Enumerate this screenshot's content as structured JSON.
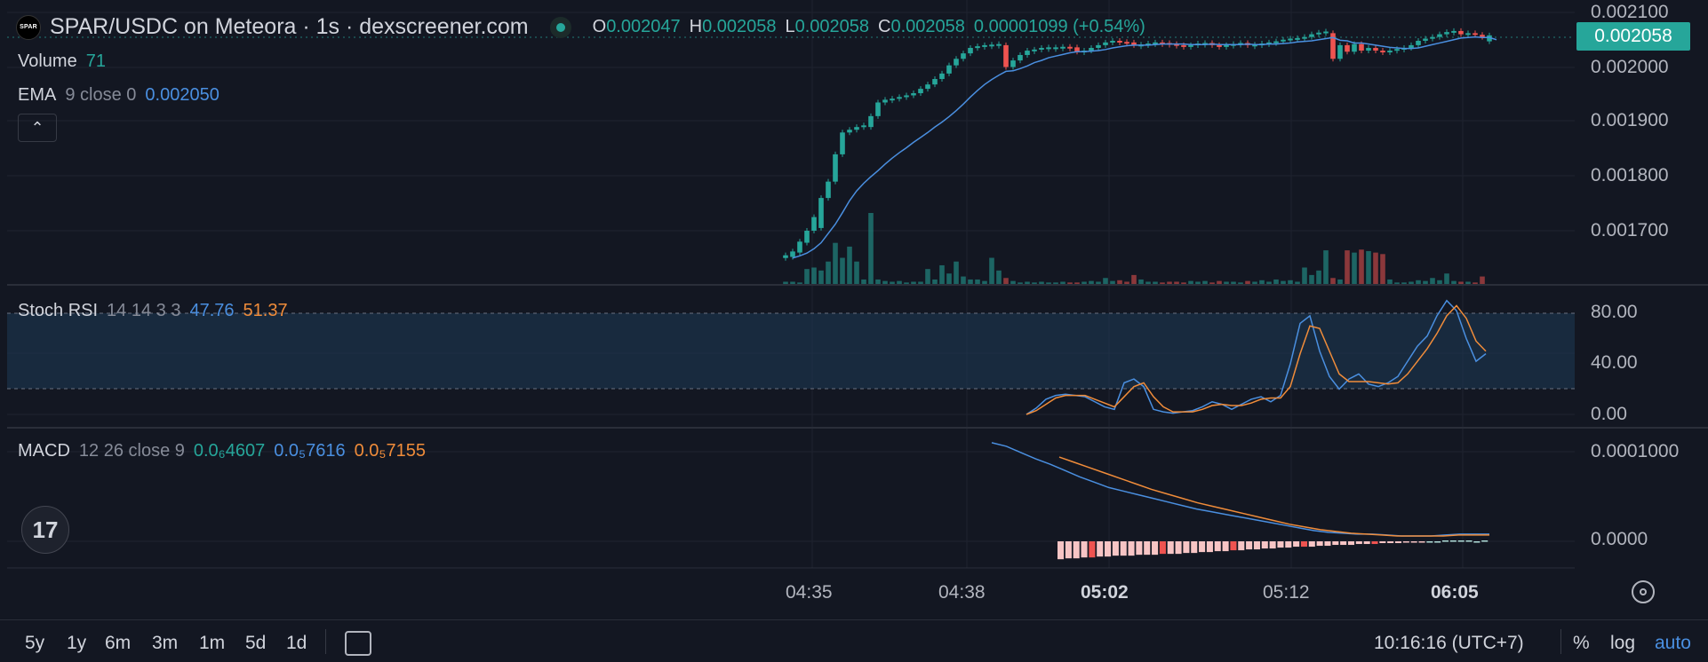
{
  "header": {
    "logo_text": "SPAR",
    "title": "SPAR/USDC on Meteora · 1s · dexscreener.com",
    "ohlc": [
      {
        "k": "O",
        "v": "0.002047"
      },
      {
        "k": "H",
        "v": "0.002058"
      },
      {
        "k": "L",
        "v": "0.002058"
      },
      {
        "k": "C",
        "v": "0.002058"
      }
    ],
    "change": "0.00001099 (+0.54%)"
  },
  "volume": {
    "label": "Volume",
    "value": "71"
  },
  "ema": {
    "label": "EMA",
    "params": "9 close 0",
    "value": "0.002050"
  },
  "stoch_rsi": {
    "label": "Stoch RSI",
    "params": "14 14 3 3",
    "k": "47.76",
    "d": "51.37"
  },
  "macd": {
    "label": "MACD",
    "params": "12 26 close 9",
    "hist": "0.0₆4607",
    "macd": "0.0₅7616",
    "signal": "0.0₅7155"
  },
  "last_price": "0.002058",
  "bottom_bar": {
    "ranges": [
      "5y",
      "1y",
      "6m",
      "3m",
      "1m",
      "5d",
      "1d"
    ],
    "clock": "10:16:16 (UTC+7)",
    "percent": "%",
    "log": "log",
    "auto": "auto"
  },
  "colors": {
    "up": "#26a69a",
    "down": "#ef5350",
    "ema": "#4a8fe0",
    "stoch_k": "#4a8fe0",
    "stoch_d": "#f08c3a",
    "background": "#131722"
  },
  "chart_data": {
    "type": "candlestick",
    "x_axis": {
      "ticks": [
        {
          "label": "04:35",
          "bold": false
        },
        {
          "label": "04:38",
          "bold": false
        },
        {
          "label": "05:02",
          "bold": true
        },
        {
          "label": "05:12",
          "bold": false
        },
        {
          "label": "06:05",
          "bold": true
        }
      ]
    },
    "price_axis": {
      "ticks": [
        "0.002100",
        "0.002000",
        "0.001900",
        "0.001800",
        "0.001700"
      ],
      "range": [
        0.00161,
        0.00211
      ]
    },
    "stoch_axis": {
      "ticks": [
        "80.00",
        "40.00",
        "0.00"
      ],
      "range": [
        -5,
        95
      ],
      "bands": [
        20,
        80
      ]
    },
    "macd_axis": {
      "ticks": [
        "0.0001000",
        "0.0000"
      ],
      "range": [
        -1.5e-05,
        0.00012
      ]
    },
    "candles": [
      {
        "o": 0.00165,
        "c": 0.001655
      },
      {
        "o": 0.001652,
        "c": 0.001662
      },
      {
        "o": 0.00166,
        "c": 0.00168
      },
      {
        "o": 0.001678,
        "c": 0.0017
      },
      {
        "o": 0.0017,
        "c": 0.001725
      },
      {
        "o": 0.001705,
        "c": 0.00176
      },
      {
        "o": 0.00176,
        "c": 0.00179
      },
      {
        "o": 0.00179,
        "c": 0.00184
      },
      {
        "o": 0.00184,
        "c": 0.00188
      },
      {
        "o": 0.00188,
        "c": 0.001885
      },
      {
        "o": 0.001885,
        "c": 0.00189
      },
      {
        "o": 0.00189,
        "c": 0.001893
      },
      {
        "o": 0.00189,
        "c": 0.00191
      },
      {
        "o": 0.00191,
        "c": 0.001935
      },
      {
        "o": 0.001935,
        "c": 0.00194
      },
      {
        "o": 0.00194,
        "c": 0.001942
      },
      {
        "o": 0.001942,
        "c": 0.001945
      },
      {
        "o": 0.001945,
        "c": 0.001948
      },
      {
        "o": 0.001948,
        "c": 0.001952
      },
      {
        "o": 0.001952,
        "c": 0.00196
      },
      {
        "o": 0.00196,
        "c": 0.001968
      },
      {
        "o": 0.001968,
        "c": 0.001978
      },
      {
        "o": 0.001978,
        "c": 0.001988
      },
      {
        "o": 0.001988,
        "c": 0.002003
      },
      {
        "o": 0.002003,
        "c": 0.002015
      },
      {
        "o": 0.002015,
        "c": 0.002025
      },
      {
        "o": 0.002025,
        "c": 0.002035
      },
      {
        "o": 0.002035,
        "c": 0.002038
      },
      {
        "o": 0.002038,
        "c": 0.00204
      },
      {
        "o": 0.00204,
        "c": 0.002041
      },
      {
        "o": 0.002041,
        "c": 0.002042
      },
      {
        "o": 0.00204,
        "c": 0.002
      },
      {
        "o": 0.002,
        "c": 0.002012
      },
      {
        "o": 0.002012,
        "c": 0.002022
      },
      {
        "o": 0.002022,
        "c": 0.00203
      },
      {
        "o": 0.00203,
        "c": 0.002032
      },
      {
        "o": 0.002032,
        "c": 0.002035
      },
      {
        "o": 0.002035,
        "c": 0.002036
      },
      {
        "o": 0.002036,
        "c": 0.002036
      },
      {
        "o": 0.002036,
        "c": 0.002037
      },
      {
        "o": 0.002037,
        "c": 0.002036
      },
      {
        "o": 0.002036,
        "c": 0.002028
      },
      {
        "o": 0.002028,
        "c": 0.00203
      },
      {
        "o": 0.00203,
        "c": 0.002035
      },
      {
        "o": 0.002035,
        "c": 0.00204
      },
      {
        "o": 0.00204,
        "c": 0.002045
      },
      {
        "o": 0.002045,
        "c": 0.002048
      },
      {
        "o": 0.002048,
        "c": 0.002046
      },
      {
        "o": 0.002046,
        "c": 0.002045
      },
      {
        "o": 0.002045,
        "c": 0.00204
      },
      {
        "o": 0.00204,
        "c": 0.002041
      },
      {
        "o": 0.002041,
        "c": 0.002043
      },
      {
        "o": 0.002043,
        "c": 0.002045
      },
      {
        "o": 0.002045,
        "c": 0.002044
      },
      {
        "o": 0.002044,
        "c": 0.002042
      },
      {
        "o": 0.002042,
        "c": 0.00204
      },
      {
        "o": 0.00204,
        "c": 0.002038
      },
      {
        "o": 0.002038,
        "c": 0.00204
      },
      {
        "o": 0.00204,
        "c": 0.002043
      },
      {
        "o": 0.002043,
        "c": 0.002044
      },
      {
        "o": 0.002044,
        "c": 0.00204
      },
      {
        "o": 0.00204,
        "c": 0.002038
      },
      {
        "o": 0.002038,
        "c": 0.00204
      },
      {
        "o": 0.00204,
        "c": 0.002042
      },
      {
        "o": 0.002042,
        "c": 0.002044
      },
      {
        "o": 0.002044,
        "c": 0.00204
      },
      {
        "o": 0.00204,
        "c": 0.002041
      },
      {
        "o": 0.002041,
        "c": 0.002043
      },
      {
        "o": 0.002043,
        "c": 0.002045
      },
      {
        "o": 0.002045,
        "c": 0.002047
      },
      {
        "o": 0.002047,
        "c": 0.00205
      },
      {
        "o": 0.00205,
        "c": 0.002052
      },
      {
        "o": 0.002052,
        "c": 0.002053
      },
      {
        "o": 0.002053,
        "c": 0.002055
      },
      {
        "o": 0.002055,
        "c": 0.00206
      },
      {
        "o": 0.00206,
        "c": 0.002063
      },
      {
        "o": 0.002063,
        "c": 0.002065
      },
      {
        "o": 0.002062,
        "c": 0.002015
      },
      {
        "o": 0.002015,
        "c": 0.00204
      },
      {
        "o": 0.00204,
        "c": 0.002028
      },
      {
        "o": 0.002028,
        "c": 0.002042
      },
      {
        "o": 0.002042,
        "c": 0.00203
      },
      {
        "o": 0.00203,
        "c": 0.002035
      },
      {
        "o": 0.002035,
        "c": 0.00203
      },
      {
        "o": 0.00203,
        "c": 0.002028
      },
      {
        "o": 0.002028,
        "c": 0.00203
      },
      {
        "o": 0.00203,
        "c": 0.002033
      },
      {
        "o": 0.002033,
        "c": 0.002035
      },
      {
        "o": 0.002035,
        "c": 0.00204
      },
      {
        "o": 0.00204,
        "c": 0.002048
      },
      {
        "o": 0.002048,
        "c": 0.002052
      },
      {
        "o": 0.002052,
        "c": 0.002055
      },
      {
        "o": 0.002055,
        "c": 0.00206
      },
      {
        "o": 0.00206,
        "c": 0.002064
      },
      {
        "o": 0.002064,
        "c": 0.002066
      },
      {
        "o": 0.002066,
        "c": 0.00206
      },
      {
        "o": 0.00206,
        "c": 0.002062
      },
      {
        "o": 0.002062,
        "c": 0.002059
      },
      {
        "o": 0.002059,
        "c": 0.002055
      },
      {
        "o": 0.002047,
        "c": 0.002058
      }
    ],
    "volumes": [
      3,
      3,
      2,
      20,
      22,
      18,
      30,
      55,
      35,
      50,
      30,
      6,
      95,
      6,
      4,
      3,
      4,
      2,
      3,
      3,
      20,
      6,
      25,
      14,
      30,
      10,
      6,
      6,
      4,
      35,
      18,
      8,
      4,
      2,
      3,
      2,
      3,
      2,
      2,
      3,
      2,
      2,
      3,
      4,
      3,
      8,
      4,
      5,
      3,
      12,
      6,
      3,
      3,
      2,
      3,
      3,
      2,
      4,
      3,
      4,
      2,
      4,
      3,
      3,
      2,
      4,
      3,
      5,
      3,
      6,
      4,
      5,
      3,
      22,
      12,
      18,
      45,
      8,
      6,
      45,
      42,
      46,
      44,
      42,
      40,
      6,
      2,
      2,
      3,
      5,
      4,
      8,
      5,
      14,
      4,
      3,
      3,
      2,
      10
    ],
    "ema_values": [
      0.00165,
      0.001654,
      0.001659,
      0.001667,
      0.001678,
      0.001695,
      0.001712,
      0.001733,
      0.001755,
      0.001773,
      0.001787,
      0.001799,
      0.00181,
      0.001822,
      0.001833,
      0.001843,
      0.001852,
      0.001862,
      0.001871,
      0.00188,
      0.00189,
      0.001899,
      0.001909,
      0.00192,
      0.001932,
      0.001945,
      0.001957,
      0.001968,
      0.001977,
      0.001985,
      0.001992,
      0.001993,
      0.001997,
      0.002002,
      0.002008,
      0.002012,
      0.002017,
      0.00202,
      0.002023,
      0.002026,
      0.002028,
      0.002028,
      0.002029,
      0.00203,
      0.002032,
      0.002035,
      0.002037,
      0.002039,
      0.00204,
      0.00204,
      0.00204,
      0.002041,
      0.002042,
      0.002042,
      0.002042,
      0.002042,
      0.002041,
      0.002041,
      0.002041,
      0.002042,
      0.002041,
      0.002041,
      0.002041,
      0.002041,
      0.002042,
      0.002041,
      0.002041,
      0.002042,
      0.002042,
      0.002043,
      0.002044,
      0.002046,
      0.002047,
      0.002048,
      0.00205,
      0.002052,
      0.002054,
      0.002049,
      0.002048,
      0.002044,
      0.002044,
      0.002042,
      0.00204,
      0.002038,
      0.002036,
      0.002035,
      0.002034,
      0.002034,
      0.002035,
      0.002038,
      0.002041,
      0.002044,
      0.002047,
      0.00205,
      0.002053,
      0.002054,
      0.002055,
      0.002054,
      0.002054,
      0.00205
    ],
    "stoch_k": [
      0,
      5,
      12,
      15,
      16,
      15,
      14,
      10,
      6,
      4,
      25,
      28,
      22,
      4,
      2,
      1,
      2,
      3,
      6,
      10,
      8,
      4,
      8,
      12,
      14,
      10,
      15,
      40,
      72,
      78,
      50,
      30,
      20,
      28,
      32,
      24,
      22,
      25,
      30,
      42,
      54,
      62,
      78,
      90,
      82,
      60,
      42,
      48
    ],
    "stoch_d": [
      0,
      3,
      8,
      13,
      15,
      15,
      15,
      12,
      9,
      6,
      14,
      22,
      25,
      14,
      6,
      2,
      2,
      2,
      4,
      7,
      8,
      7,
      7,
      9,
      12,
      13,
      13,
      22,
      48,
      70,
      68,
      50,
      32,
      26,
      26,
      26,
      25,
      24,
      25,
      32,
      42,
      52,
      64,
      78,
      86,
      76,
      58,
      50
    ],
    "macd_line": [
      0.00011,
      0.000106,
      9.9e-05,
      9.2e-05,
      8.6e-05,
      7.9e-05,
      7.2e-05,
      6.6e-05,
      6e-05,
      5.6e-05,
      5.2e-05,
      4.8e-05,
      4.4e-05,
      4e-05,
      3.6e-05,
      3.3e-05,
      3e-05,
      2.7e-05,
      2.4e-05,
      2.1e-05,
      1.8e-05,
      1.5e-05,
      1.2e-05,
      1e-05,
      9e-06,
      8e-06,
      8e-06,
      7e-06,
      6e-06,
      6e-06,
      6e-06,
      7e-06,
      8e-06,
      8e-06,
      8e-06
    ],
    "signal_line": [
      9.4e-05,
      8.8e-05,
      8.2e-05,
      7.6e-05,
      7e-05,
      6.4e-05,
      5.8e-05,
      5.3e-05,
      4.8e-05,
      4.3e-05,
      3.9e-05,
      3.5e-05,
      3.1e-05,
      2.7e-05,
      2.3e-05,
      1.9e-05,
      1.6e-05,
      1.3e-05,
      1.1e-05,
      9e-06,
      8e-06,
      7e-06,
      6e-06,
      6e-06,
      6e-06,
      6e-06,
      7e-06,
      7e-06,
      7e-06
    ],
    "macd_hist": [
      -2e-05,
      -1.9e-05,
      -1.9e-05,
      -1.8e-05,
      -1.8e-05,
      -1.7e-05,
      -1.7e-05,
      -1.6e-05,
      -1.6e-05,
      -1.6e-05,
      -1.5e-05,
      -1.5e-05,
      -1.5e-05,
      -1.4e-05,
      -1.4e-05,
      -1.4e-05,
      -1.3e-05,
      -1.3e-05,
      -1.2e-05,
      -1.2e-05,
      -1.1e-05,
      -1.1e-05,
      -1e-05,
      -1e-05,
      -9e-06,
      -9e-06,
      -8e-06,
      -8e-06,
      -7e-06,
      -7e-06,
      -6e-06,
      -6e-06,
      -6e-06,
      -5e-06,
      -5e-06,
      -4e-06,
      -4e-06,
      -4e-06,
      -3e-06,
      -3e-06,
      -3e-06,
      -2e-06,
      -2e-06,
      -2e-06,
      -1e-06,
      -1e-06,
      -1e-06,
      0.0,
      0.0,
      1e-06,
      1e-06,
      1e-06,
      1e-06,
      0.0,
      1e-06
    ]
  }
}
